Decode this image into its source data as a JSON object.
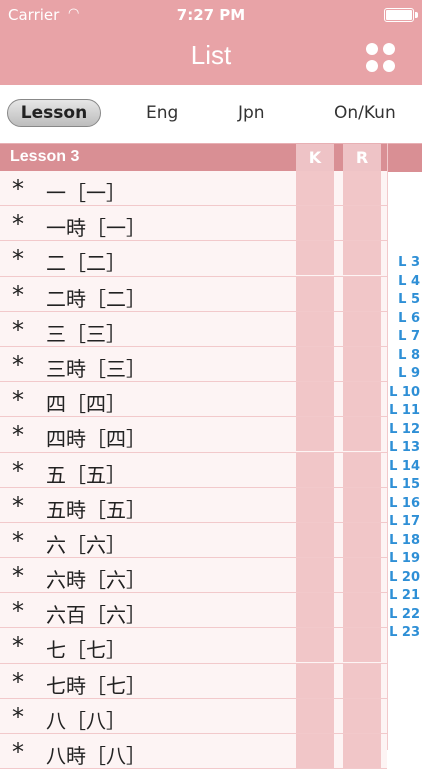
{
  "status_bar": {
    "carrier": "Carrier",
    "time": "7:27 PM"
  },
  "nav": {
    "title": "List"
  },
  "tabs": [
    "Lesson",
    "Eng",
    "Jpn",
    "On/Kun"
  ],
  "section": {
    "label": "Lesson 3",
    "col_k": "K",
    "col_r": "R"
  },
  "rows": [
    {
      "star": "*",
      "text": "一［一］"
    },
    {
      "star": "*",
      "text": "一時［一］"
    },
    {
      "star": "*",
      "text": "二［二］"
    },
    {
      "star": "*",
      "text": "二時［二］"
    },
    {
      "star": "*",
      "text": "三［三］"
    },
    {
      "star": "*",
      "text": "三時［三］"
    },
    {
      "star": "*",
      "text": "四［四］"
    },
    {
      "star": "*",
      "text": "四時［四］"
    },
    {
      "star": "*",
      "text": "五［五］"
    },
    {
      "star": "*",
      "text": "五時［五］"
    },
    {
      "star": "*",
      "text": "六［六］"
    },
    {
      "star": "*",
      "text": "六時［六］"
    },
    {
      "star": "*",
      "text": "六百［六］"
    },
    {
      "star": "*",
      "text": "七［七］"
    },
    {
      "star": "*",
      "text": "七時［七］"
    },
    {
      "star": "*",
      "text": "八［八］"
    },
    {
      "star": "*",
      "text": "八時［八］"
    }
  ],
  "index": [
    "L 3",
    "L 4",
    "L 5",
    "L 6",
    "L 7",
    "L 8",
    "L 9",
    "L 10",
    "L 11",
    "L 12",
    "L 13",
    "L 14",
    "L 15",
    "L 16",
    "L 17",
    "L 18",
    "L 19",
    "L 20",
    "L 21",
    "L 22",
    "L 23"
  ]
}
